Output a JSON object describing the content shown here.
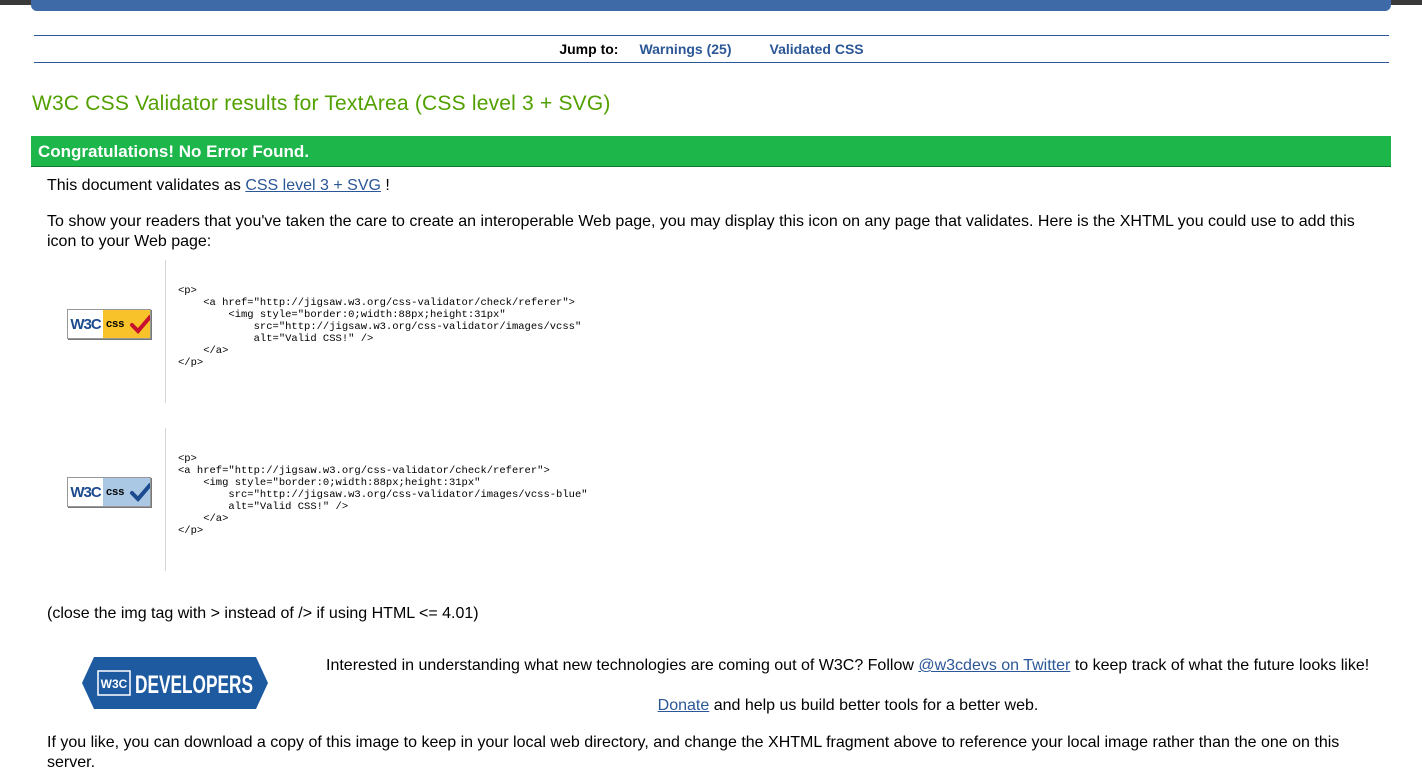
{
  "jump_nav": {
    "label": "Jump to:",
    "warnings_link": "Warnings (25)",
    "validated_link": "Validated CSS"
  },
  "title": "W3C CSS Validator results for TextArea (CSS level 3 + SVG)",
  "congrats": "Congratulations! No Error Found.",
  "validates": {
    "prefix": "This document validates as",
    "link": "CSS level 3 + SVG",
    "suffix": "!"
  },
  "intro_text": "To show your readers that you've taken the care to create an interoperable Web page, you may display this icon on any page that validates. Here is the XHTML you could use to add this icon to your Web page:",
  "badges": [
    {
      "w3c_text": "W3C",
      "css_text": "css",
      "style": "gold",
      "code": "<p>\n    <a href=\"http://jigsaw.w3.org/css-validator/check/referer\">\n        <img style=\"border:0;width:88px;height:31px\"\n            src=\"http://jigsaw.w3.org/css-validator/images/vcss\"\n            alt=\"Valid CSS!\" />\n    </a>\n</p>"
    },
    {
      "w3c_text": "W3C",
      "css_text": "css",
      "style": "blue",
      "code": "<p>\n<a href=\"http://jigsaw.w3.org/css-validator/check/referer\">\n    <img style=\"border:0;width:88px;height:31px\"\n        src=\"http://jigsaw.w3.org/css-validator/images/vcss-blue\"\n        alt=\"Valid CSS!\" />\n    </a>\n</p>"
    }
  ],
  "close_note": "(close the img tag with > instead of /> if using HTML <= 4.01)",
  "developers": {
    "logo_w3c": "W3C",
    "logo_text": "DEVELOPERS",
    "interest_prefix": "Interested in understanding what new technologies are coming out of W3C? Follow",
    "twitter_link": "@w3cdevs on Twitter",
    "interest_suffix": "to keep track of what the future looks like!",
    "donate_link": "Donate",
    "donate_suffix": "and help us build better tools for a better web."
  },
  "download_text": "If you like, you can download a copy of this image to keep in your local web directory, and change the XHTML fragment above to reference your local image rather than the one on this server.",
  "colors": {
    "link": "#2b5797",
    "title_green": "#51a000",
    "congrats_green": "#1db64a",
    "badge_gold": "#f7c22a",
    "badge_blue": "#aac8e4",
    "developers_blue": "#1e5aa0"
  }
}
